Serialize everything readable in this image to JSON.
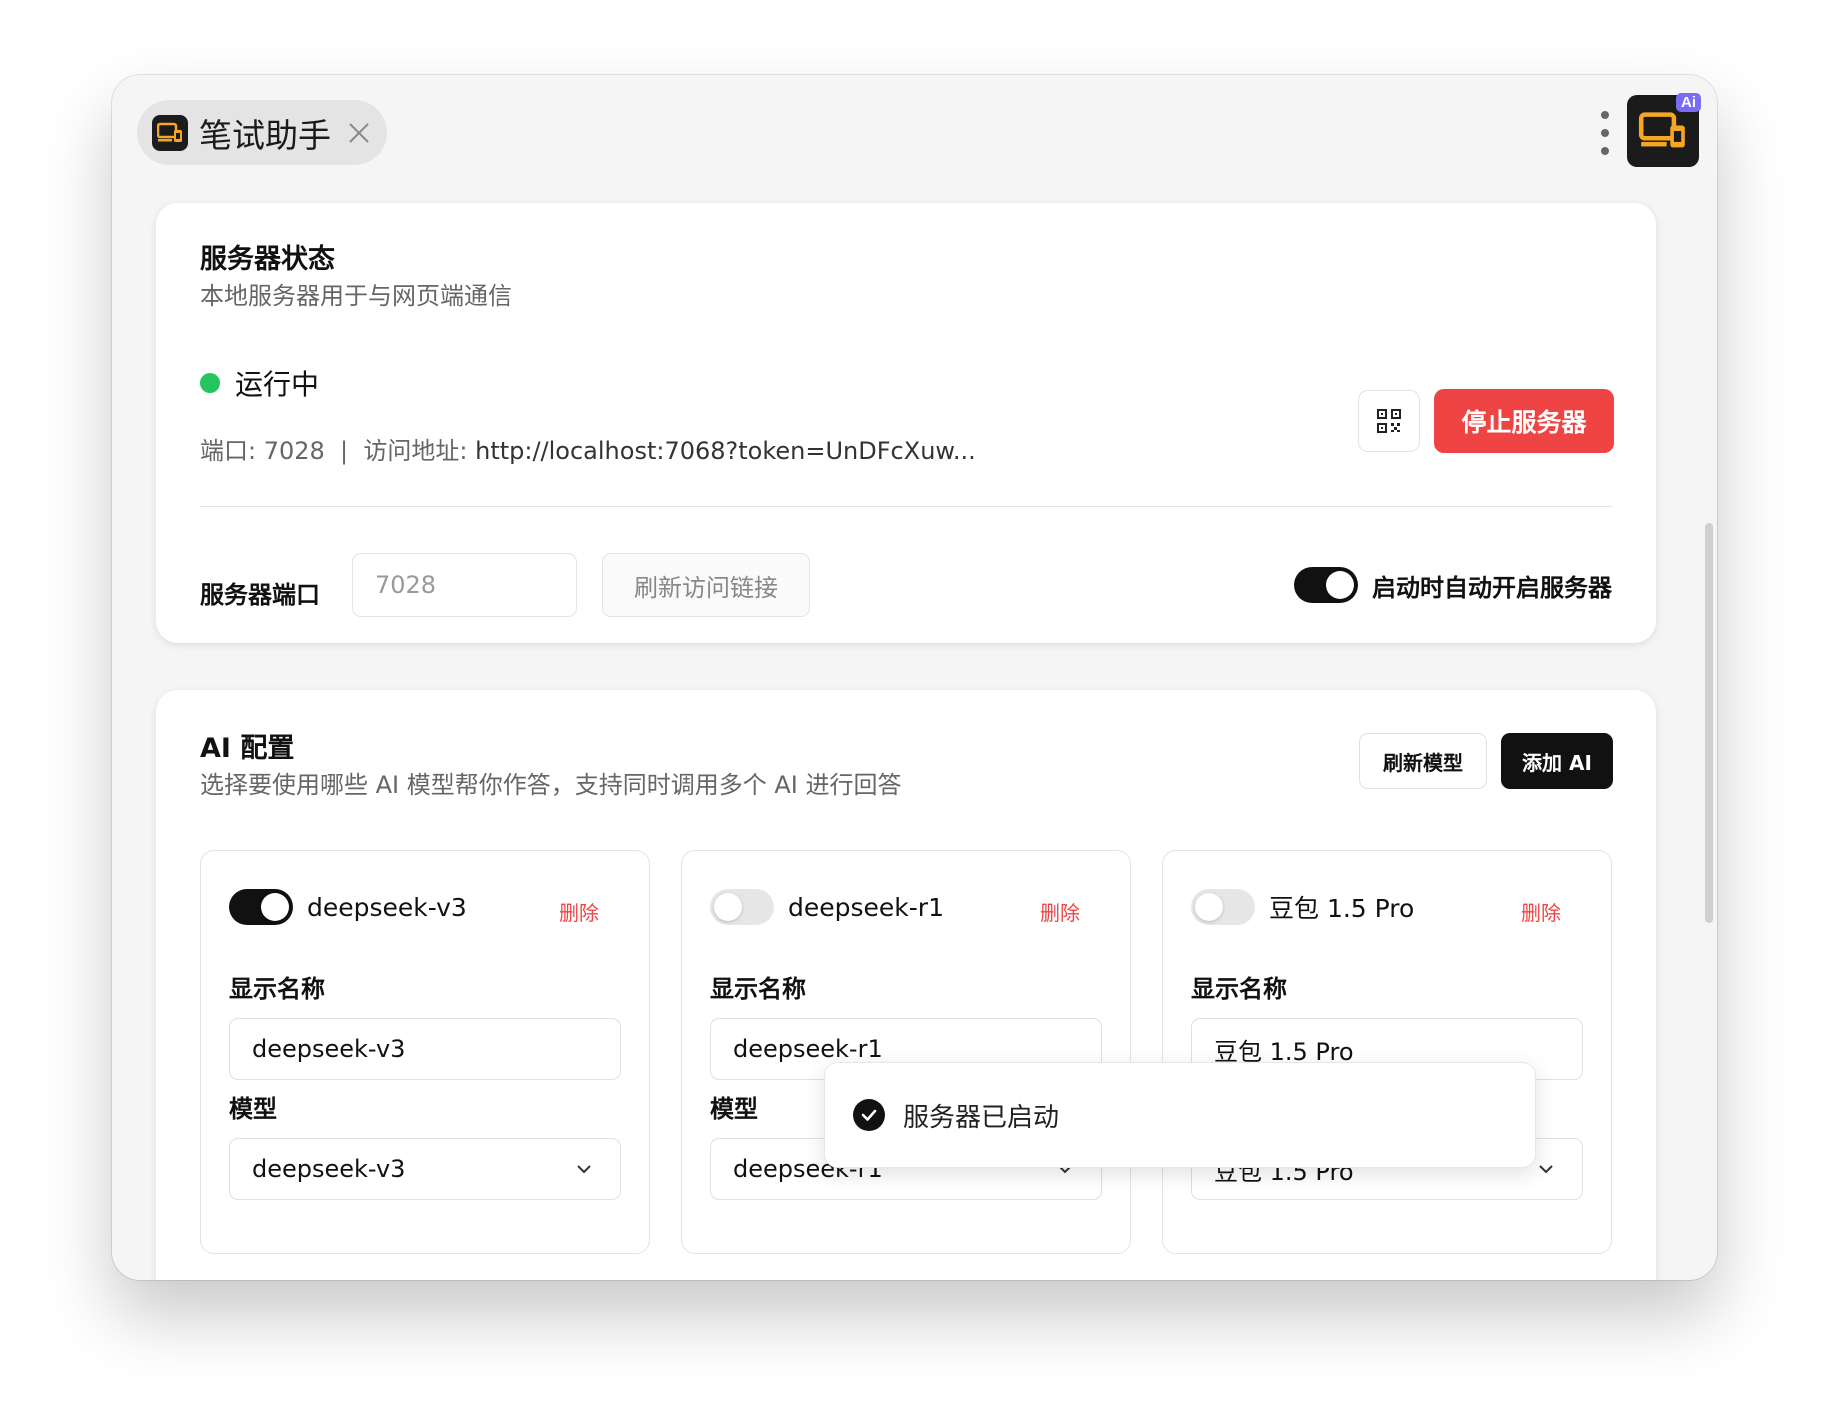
{
  "window": {
    "tab_title": "笔试助手",
    "ai_badge": "Ai"
  },
  "server": {
    "title": "服务器状态",
    "subtitle": "本地服务器用于与网页端通信",
    "status_text": "运行中",
    "port_prefix": "端口: 7028  |  访问地址: ",
    "url": "http://localhost:7068?token=UnDFcXuw...",
    "stop_label": "停止服务器",
    "port_label": "服务器端口",
    "port_placeholder": "7028",
    "refresh_link_label": "刷新访问链接",
    "auto_start_label": "启动时自动开启服务器",
    "auto_start_on": true
  },
  "ai_config": {
    "title": "AI 配置",
    "subtitle": "选择要使用哪些 AI 模型帮你作答，支持同时调用多个 AI 进行回答",
    "refresh_label": "刷新模型",
    "add_label": "添加 AI",
    "display_name_label": "显示名称",
    "model_label": "模型",
    "delete_label": "删除",
    "models": [
      {
        "name": "deepseek-v3",
        "enabled": true,
        "display_name": "deepseek-v3",
        "model": "deepseek-v3"
      },
      {
        "name": "deepseek-r1",
        "enabled": false,
        "display_name": "deepseek-r1",
        "model": "deepseek-r1"
      },
      {
        "name": "豆包 1.5 Pro",
        "enabled": false,
        "display_name": "豆包 1.5 Pro",
        "model": "豆包 1.5 Pro"
      }
    ]
  },
  "toast": {
    "message": "服务器已启动"
  },
  "colors": {
    "running": "#22c55e",
    "danger": "#ef4444",
    "primary": "#111111",
    "badge": "#7b6cf6"
  }
}
